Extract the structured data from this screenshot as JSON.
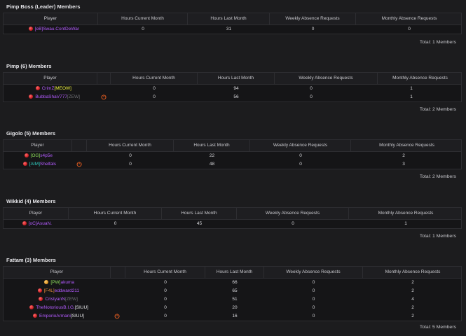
{
  "columns": [
    "Player",
    "Hours Current Month",
    "Hours Last Month",
    "Weekly Absence Requests",
    "Monthly Absence Requests"
  ],
  "groups": [
    {
      "title": "Pimp Boss (Leader) Members",
      "total": "Total: 1 Members",
      "members": [
        {
          "tag": "[eB]",
          "name": "Swau.ContDeWar",
          "suffix": "",
          "status": "offline",
          "power": false,
          "hcm": "0",
          "hlm": "31",
          "war": "0",
          "mar": "0"
        }
      ]
    },
    {
      "title": "Pimp (6) Members",
      "total": "Total: 2 Members",
      "members": [
        {
          "tag": "",
          "name": "CrimZ",
          "suffix": "[MEOW]",
          "status": "offline",
          "power": false,
          "hcm": "0",
          "hlm": "94",
          "war": "0",
          "mar": "1"
        },
        {
          "tag": "",
          "name": "BubbaShaV777",
          "suffix": "[ZEW]",
          "status": "offline",
          "power": true,
          "hcm": "0",
          "hlm": "56",
          "war": "0",
          "mar": "1"
        }
      ]
    },
    {
      "title": "Gigolo (5) Members",
      "total": "Total: 2 Members",
      "members": [
        {
          "tag": "[OG]",
          "name": "s4p5e",
          "suffix": "",
          "status": "offline",
          "power": false,
          "hcm": "0",
          "hlm": "22",
          "war": "0",
          "mar": "2"
        },
        {
          "tag": "[AIM]",
          "name": "Shelfals",
          "suffix": "",
          "status": "offline",
          "power": true,
          "hcm": "0",
          "hlm": "48",
          "war": "0",
          "mar": "3"
        }
      ]
    },
    {
      "title": "Wikkid (4) Members",
      "total": "Total: 1 Members",
      "members": [
        {
          "tag": "[oC]",
          "name": "AsuaN.",
          "suffix": "",
          "status": "offline",
          "power": false,
          "hcm": "0",
          "hlm": "45",
          "war": "0",
          "mar": "1"
        }
      ]
    },
    {
      "title": "Fattam (3) Members",
      "total": "Total: 5 Members",
      "members": [
        {
          "tag": "[PW]",
          "name": "akuma",
          "suffix": "",
          "status": "away",
          "power": false,
          "hcm": "0",
          "hlm": "66",
          "war": "0",
          "mar": "2"
        },
        {
          "tag": "[F4L]",
          "name": "eddward211",
          "suffix": "",
          "status": "offline",
          "power": false,
          "hcm": "0",
          "hlm": "65",
          "war": "0",
          "mar": "2"
        },
        {
          "tag": "",
          "name": "CristyanN",
          "suffix": "[ZEW]",
          "status": "offline",
          "power": false,
          "hcm": "0",
          "hlm": "51",
          "war": "0",
          "mar": "4"
        },
        {
          "tag": "",
          "name": "TheNotoriousB.I.G.",
          "suffix": "[SIUU]",
          "status": "offline",
          "power": false,
          "hcm": "0",
          "hlm": "20",
          "war": "0",
          "mar": "2"
        },
        {
          "tag": "",
          "name": "EmporioArmani",
          "suffix": "[SIUU]",
          "status": "offline",
          "power": true,
          "hcm": "0",
          "hlm": "16",
          "war": "0",
          "mar": "2"
        }
      ]
    }
  ],
  "colors": {
    "background": "#1c1c1e",
    "row_background": "#151517",
    "offline_dot": "#c4161c",
    "away_dot": "#d88a17",
    "power_icon": "#e05a1f"
  },
  "icons": {
    "status": "status-dot-icon",
    "power": "power-icon"
  }
}
